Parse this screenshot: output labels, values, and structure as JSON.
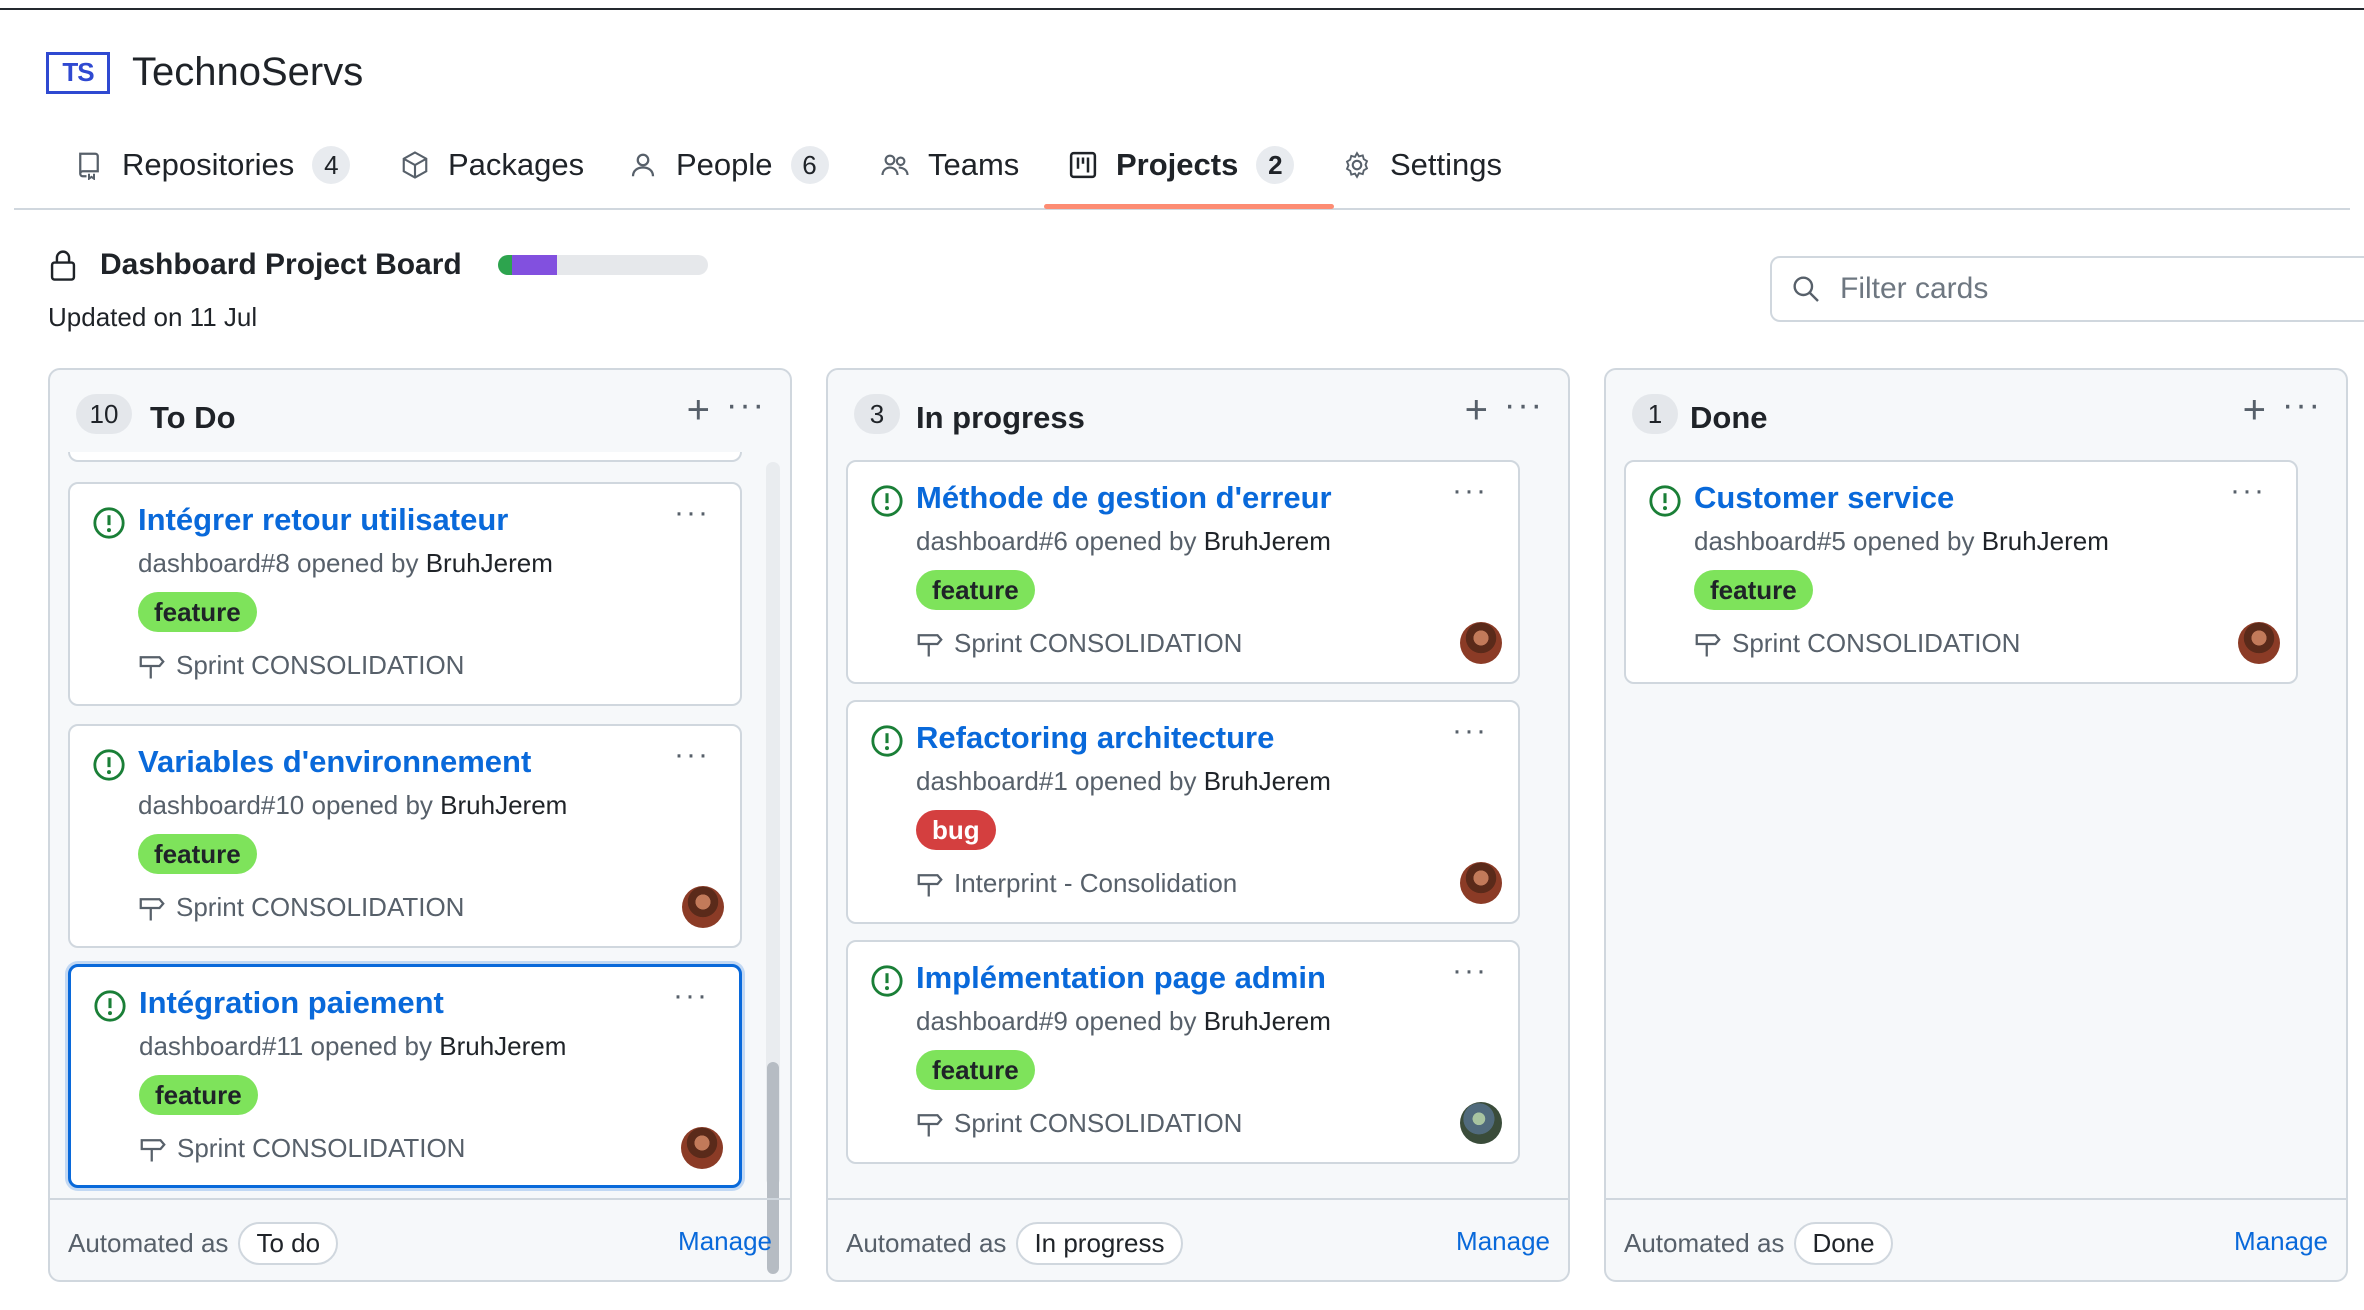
{
  "org": {
    "logo_text": "TS",
    "name": "TechnoServs"
  },
  "nav": {
    "items": [
      {
        "label": "Repositories",
        "count": "4",
        "icon": "repo-icon"
      },
      {
        "label": "Packages",
        "count": "",
        "icon": "package-icon"
      },
      {
        "label": "People",
        "count": "6",
        "icon": "person-icon"
      },
      {
        "label": "Teams",
        "count": "",
        "icon": "people-icon"
      },
      {
        "label": "Projects",
        "count": "2",
        "icon": "project-icon",
        "selected": true
      },
      {
        "label": "Settings",
        "count": "",
        "icon": "gear-icon"
      }
    ]
  },
  "project": {
    "title": "Dashboard Project Board",
    "updated": "Updated on 11 Jul",
    "progress": {
      "done_fraction": 0.07,
      "in_progress_fraction": 0.21
    },
    "colors": {
      "done": "#2da44e",
      "in_progress": "#8250df"
    }
  },
  "filter": {
    "placeholder": "Filter cards"
  },
  "columns": [
    {
      "name": "To Do",
      "count": "10",
      "automated_label": "Automated as",
      "automated_value": "To do",
      "manage": "Manage",
      "cards": [
        {
          "title": "Intégrer retour utilisateur",
          "meta": "dashboard#8 opened by",
          "user": "BruhJerem",
          "label": "feature",
          "label_type": "feature",
          "milestone": "Sprint CONSOLIDATION",
          "avatar": false
        },
        {
          "title": "Variables d'environnement",
          "meta": "dashboard#10 opened by",
          "user": "BruhJerem",
          "label": "feature",
          "label_type": "feature",
          "milestone": "Sprint CONSOLIDATION",
          "avatar": true
        },
        {
          "title": "Intégration paiement",
          "meta": "dashboard#11 opened by",
          "user": "BruhJerem",
          "label": "feature",
          "label_type": "feature",
          "milestone": "Sprint CONSOLIDATION",
          "avatar": true,
          "focused": true
        }
      ]
    },
    {
      "name": "In progress",
      "count": "3",
      "automated_label": "Automated as",
      "automated_value": "In progress",
      "manage": "Manage",
      "cards": [
        {
          "title": "Méthode de gestion d'erreur",
          "meta": "dashboard#6 opened by",
          "user": "BruhJerem",
          "label": "feature",
          "label_type": "feature",
          "milestone": "Sprint CONSOLIDATION",
          "avatar": true
        },
        {
          "title": "Refactoring architecture",
          "meta": "dashboard#1 opened by",
          "user": "BruhJerem",
          "label": "bug",
          "label_type": "bug",
          "milestone": "Interprint - Consolidation",
          "avatar": true
        },
        {
          "title": "Implémentation page admin",
          "meta": "dashboard#9 opened by",
          "user": "BruhJerem",
          "label": "feature",
          "label_type": "feature",
          "milestone": "Sprint CONSOLIDATION",
          "avatar": true,
          "avatar_alt": true
        }
      ]
    },
    {
      "name": "Done",
      "count": "1",
      "automated_label": "Automated as",
      "automated_value": "Done",
      "manage": "Manage",
      "cards": [
        {
          "title": "Customer service",
          "meta": "dashboard#5 opened by",
          "user": "BruhJerem",
          "label": "feature",
          "label_type": "feature",
          "milestone": "Sprint CONSOLIDATION",
          "avatar": true
        }
      ]
    }
  ],
  "colors": {
    "accent": "#0969da",
    "feature": "#7ee35b",
    "bug": "#d43f3f",
    "open_issue": "#1a7f37",
    "nav_underline": "#fd8c73"
  }
}
